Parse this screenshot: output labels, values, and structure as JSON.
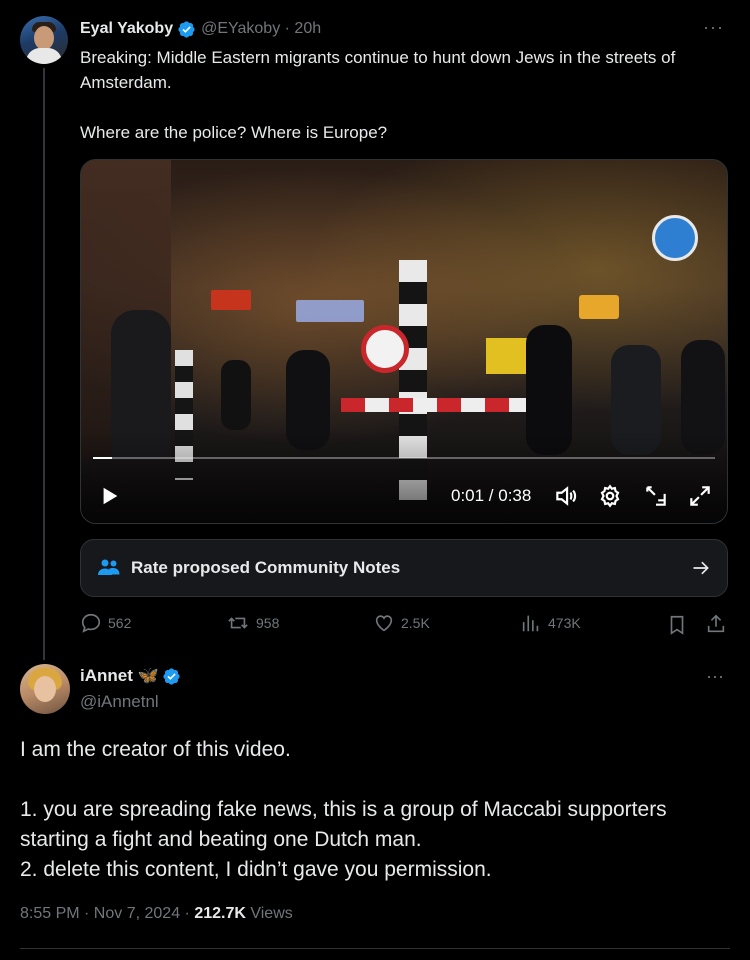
{
  "tweet": {
    "author_name": "Eyal Yakoby",
    "handle_time": "@EYakoby · 20h",
    "more_label": "···",
    "text_line1": "Breaking: Middle Eastern migrants continue to hunt down Jews in the streets of Amsterdam.",
    "text_line2": "Where are the police? Where is Europe?",
    "video": {
      "time": "0:01 / 0:38",
      "progress": 0.03
    },
    "community_notes_label": "Rate proposed Community Notes",
    "actions": {
      "replies": "562",
      "reposts": "958",
      "likes": "2.5K",
      "views": "473K"
    }
  },
  "reply": {
    "author_name": "iAnnet",
    "author_emoji": "🦋",
    "handle": "@iAnnetnl",
    "more_label": "···",
    "para1": "I am the creator of this video.",
    "para2": "1. you are spreading fake news, this is a group of Maccabi supporters starting a fight and beating one Dutch man.",
    "para3": "2. delete this content, I didn’t gave you permission.",
    "timestamp": "8:55 PM · Nov 7, 2024 · ",
    "views_count": "212.7K",
    "views_label": " Views"
  },
  "colors": {
    "background": "#000000",
    "text": "#e7e9ea",
    "muted": "#71767b",
    "verified": "#1d9bf0"
  },
  "icons": [
    "verified-badge-icon",
    "more-icon",
    "play-icon",
    "volume-icon",
    "settings-icon",
    "pip-icon",
    "fullscreen-icon",
    "community-notes-icon",
    "arrow-right-icon",
    "reply-icon",
    "repost-icon",
    "like-icon",
    "views-icon",
    "bookmark-icon",
    "share-icon"
  ]
}
